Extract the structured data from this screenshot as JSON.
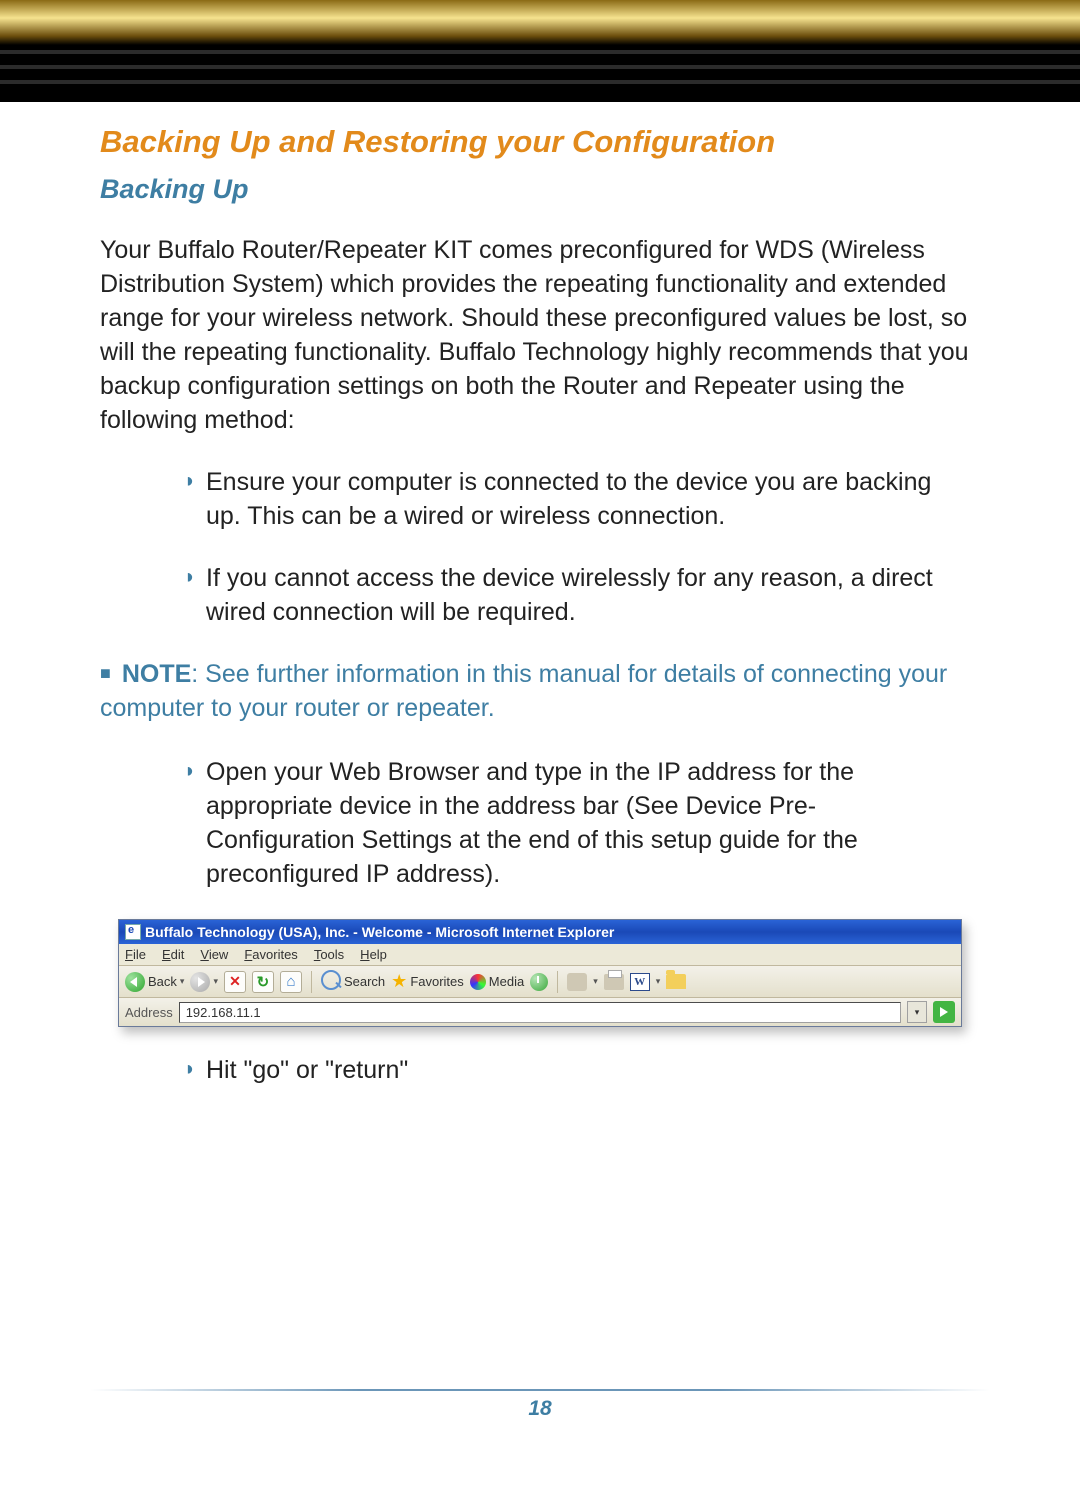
{
  "title": "Backing Up and Restoring your Configuration",
  "subtitle": "Backing Up",
  "intro": "Your Buffalo Router/Repeater KIT comes preconfigured for WDS (Wireless Distribution System) which provides the repeating functionality and extended range for your wireless network.  Should these preconfigured values be lost, so will the repeating functionality.  Buffalo Technology highly recommends that you backup configuration settings on both the Router and Repeater using the following method:",
  "bullets1": [
    "Ensure your computer is connected to the device you are backing up. This can be a wired or wireless connection.",
    "If you cannot access the device wirelessly for any reason, a direct wired connection will be required."
  ],
  "note_label": "NOTE",
  "note_text": ": See further information in this manual for details of connecting your computer to your router or repeater.",
  "bullets2": [
    "Open your Web Browser and type in the IP address for the appropriate device in the address bar (See Device Pre-Configuration Settings at the end of this setup guide for the preconfigured IP address)."
  ],
  "bullets3": [
    "Hit \"go\" or \"return\""
  ],
  "ie": {
    "title": "Buffalo Technology (USA), Inc. - Welcome - Microsoft Internet Explorer",
    "menu": [
      "File",
      "Edit",
      "View",
      "Favorites",
      "Tools",
      "Help"
    ],
    "back": "Back",
    "search": "Search",
    "favorites": "Favorites",
    "media": "Media",
    "address_label": "Address",
    "address_value": "192.168.11.1"
  },
  "page_number": "18"
}
